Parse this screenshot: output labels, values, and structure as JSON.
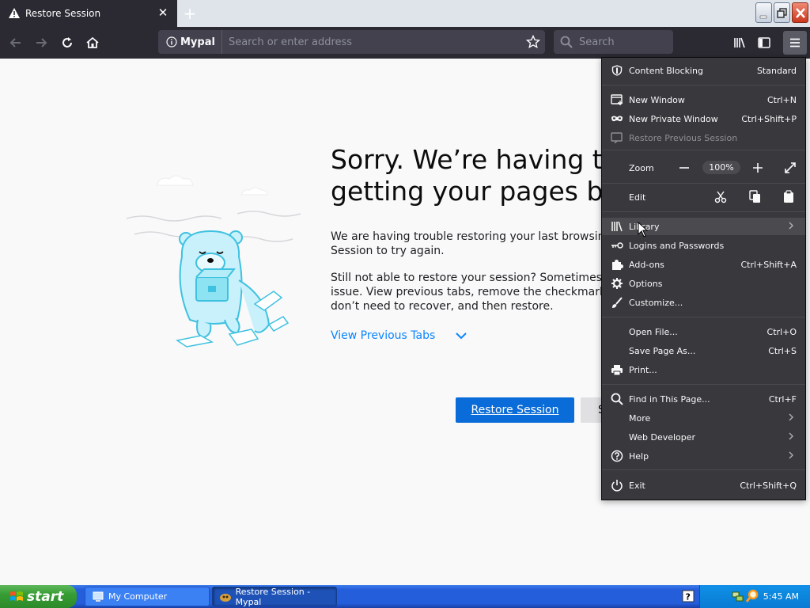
{
  "tab": {
    "title": "Restore Session",
    "icon": "warning-icon"
  },
  "toolbar": {
    "site_label": "Mypal",
    "address_placeholder": "Search or enter address",
    "search_placeholder": "Search"
  },
  "page": {
    "heading": "Sorry. We’re having trou\ngetting your pages back",
    "para1": "We are having trouble restoring your last browsing se\nSession to try again.",
    "para2": "Still not able to restore your session? Sometimes a ta\nissue. View previous tabs, remove the checkmark fro\ndon’t need to recover, and then restore.",
    "view_tabs": "View Previous Tabs",
    "restore_button": "Restore Session",
    "second_button": "S"
  },
  "menu": {
    "content_blocking": {
      "label": "Content Blocking",
      "value": "Standard"
    },
    "new_window": {
      "label": "New Window",
      "shortcut": "Ctrl+N"
    },
    "new_private": {
      "label": "New Private Window",
      "shortcut": "Ctrl+Shift+P"
    },
    "restore_prev": {
      "label": "Restore Previous Session"
    },
    "zoom": {
      "label": "Zoom",
      "value": "100%"
    },
    "edit": {
      "label": "Edit"
    },
    "library": {
      "label": "Library"
    },
    "logins": {
      "label": "Logins and Passwords"
    },
    "addons": {
      "label": "Add-ons",
      "shortcut": "Ctrl+Shift+A"
    },
    "options": {
      "label": "Options"
    },
    "customize": {
      "label": "Customize..."
    },
    "open_file": {
      "label": "Open File...",
      "shortcut": "Ctrl+O"
    },
    "save_page": {
      "label": "Save Page As...",
      "shortcut": "Ctrl+S"
    },
    "print": {
      "label": "Print..."
    },
    "find": {
      "label": "Find in This Page...",
      "shortcut": "Ctrl+F"
    },
    "more": {
      "label": "More"
    },
    "web_dev": {
      "label": "Web Developer"
    },
    "help": {
      "label": "Help"
    },
    "exit": {
      "label": "Exit",
      "shortcut": "Ctrl+Shift+Q"
    }
  },
  "taskbar": {
    "start": "start",
    "tasks": [
      "My Computer",
      "Restore Session - Mypal"
    ],
    "clock": "5:45 AM"
  },
  "colors": {
    "accent": "#0a84ff",
    "button": "#0a6cd8",
    "menu_bg": "#38383d",
    "toolbar_bg": "#2b2a33"
  }
}
